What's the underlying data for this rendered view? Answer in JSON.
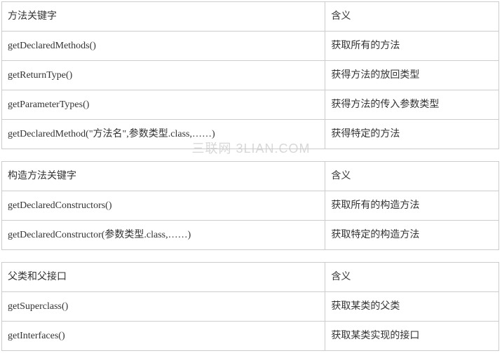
{
  "watermark": "三联网 3LIAN.COM",
  "table1": {
    "header": {
      "left": "方法关键字",
      "right": "含义"
    },
    "rows": [
      {
        "left": "getDeclaredMethods()",
        "right": "获取所有的方法"
      },
      {
        "left": "getReturnType()",
        "right": "获得方法的放回类型"
      },
      {
        "left": "getParameterTypes()",
        "right": "获得方法的传入参数类型"
      },
      {
        "left": "getDeclaredMethod(\"方法名\",参数类型.class,……)",
        "right": "获得特定的方法"
      }
    ]
  },
  "table2": {
    "header": {
      "left": "构造方法关键字",
      "right": "含义"
    },
    "rows": [
      {
        "left": "getDeclaredConstructors()",
        "right": "获取所有的构造方法"
      },
      {
        "left": "getDeclaredConstructor(参数类型.class,……)",
        "right": "获取特定的构造方法"
      }
    ]
  },
  "table3": {
    "header": {
      "left": "父类和父接口",
      "right": "含义"
    },
    "rows": [
      {
        "left": "getSuperclass()",
        "right": "获取某类的父类"
      },
      {
        "left": "getInterfaces()",
        "right": "获取某类实现的接口"
      }
    ]
  }
}
